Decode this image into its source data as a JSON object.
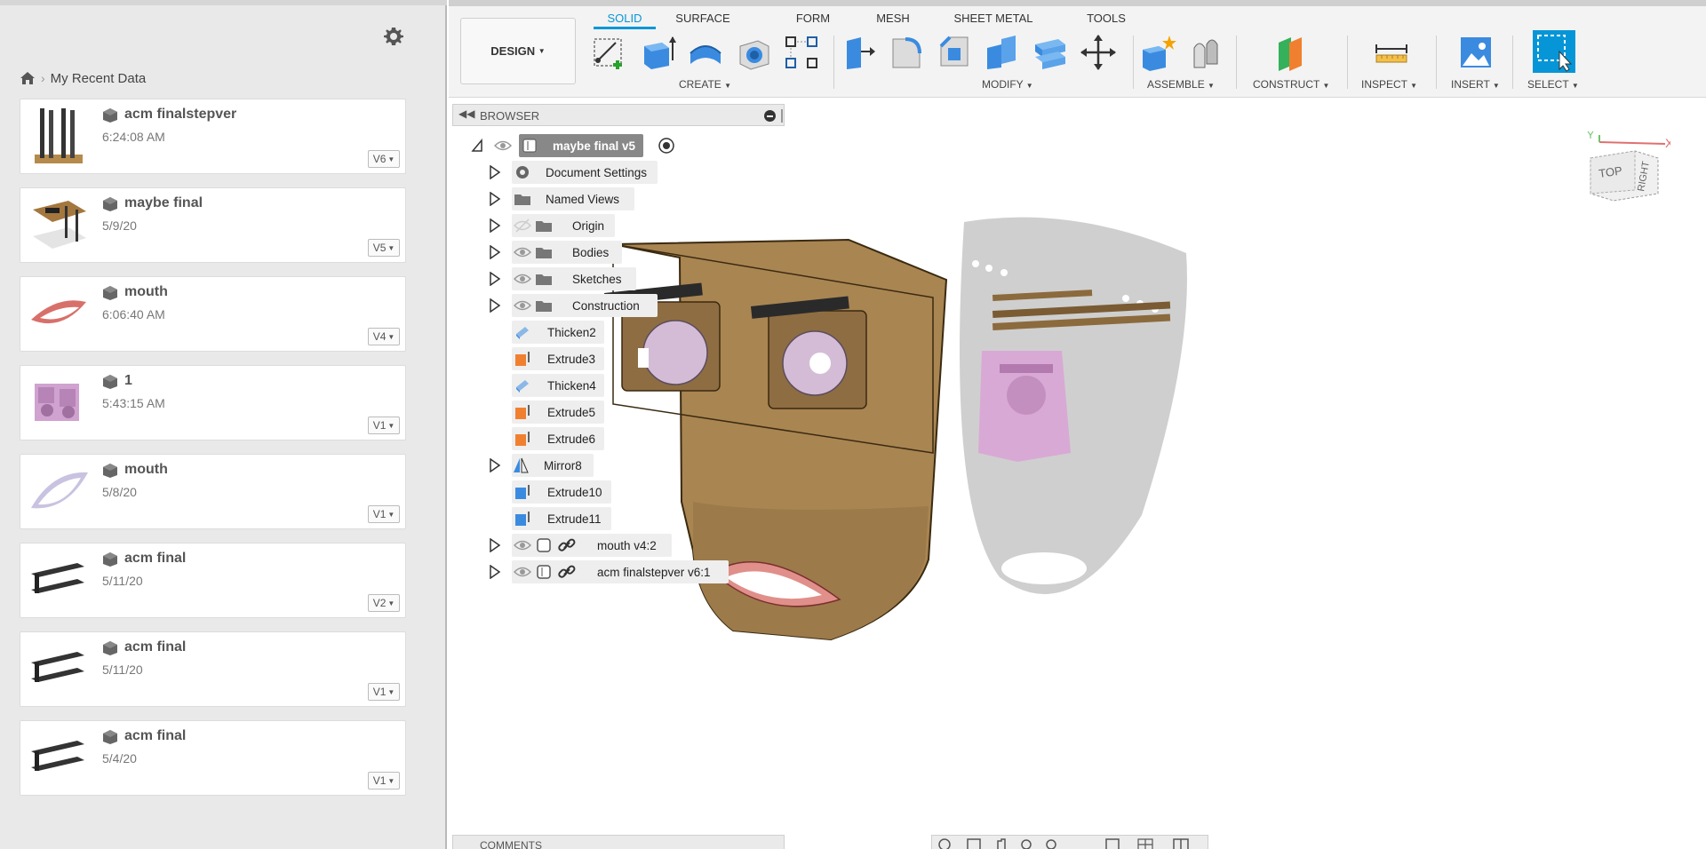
{
  "left_panel": {
    "breadcrumb_label": "My Recent Data",
    "files": [
      {
        "name": "acm finalstepver",
        "date": "6:24:08 AM",
        "version": "V6"
      },
      {
        "name": "maybe final",
        "date": "5/9/20",
        "version": "V5"
      },
      {
        "name": "mouth",
        "date": "6:06:40 AM",
        "version": "V4"
      },
      {
        "name": "1",
        "date": "5:43:15 AM",
        "version": "V1"
      },
      {
        "name": "mouth",
        "date": "5/8/20",
        "version": "V1"
      },
      {
        "name": "acm final",
        "date": "5/11/20",
        "version": "V2"
      },
      {
        "name": "acm final",
        "date": "5/11/20",
        "version": "V1"
      },
      {
        "name": "acm final",
        "date": "5/4/20",
        "version": "V1"
      }
    ]
  },
  "toolbar": {
    "design_label": "DESIGN",
    "tabs": [
      "SOLID",
      "SURFACE",
      "FORM",
      "MESH",
      "SHEET METAL",
      "TOOLS"
    ],
    "active_tab": "SOLID",
    "groups": [
      "CREATE",
      "MODIFY",
      "ASSEMBLE",
      "CONSTRUCT",
      "INSPECT",
      "INSERT",
      "SELECT"
    ],
    "accent_color": "#0696d7"
  },
  "browser": {
    "title": "BROWSER",
    "root": "maybe final v5",
    "items": [
      {
        "label": "Document Settings",
        "icon": "gear-icon"
      },
      {
        "label": "Named Views",
        "icon": "folder-icon"
      },
      {
        "label": "Origin",
        "icon": "folder-icon"
      },
      {
        "label": "Bodies",
        "icon": "folder-icon"
      },
      {
        "label": "Sketches",
        "icon": "folder-icon"
      },
      {
        "label": "Construction",
        "icon": "folder-icon"
      },
      {
        "label": "Thicken2",
        "icon": "thicken-icon"
      },
      {
        "label": "Extrude3",
        "icon": "extrude-icon"
      },
      {
        "label": "Thicken4",
        "icon": "thicken-icon"
      },
      {
        "label": "Extrude5",
        "icon": "extrude-icon"
      },
      {
        "label": "Extrude6",
        "icon": "extrude-icon"
      },
      {
        "label": "Mirror8",
        "icon": "mirror-icon"
      },
      {
        "label": "Extrude10",
        "icon": "extrude-icon"
      },
      {
        "label": "Extrude11",
        "icon": "extrude-icon"
      },
      {
        "label": "mouth v4:2",
        "icon": "component-link-icon"
      },
      {
        "label": "acm finalstepver v6:1",
        "icon": "component-link-icon"
      }
    ]
  },
  "viewcube": {
    "top": "TOP",
    "right": "RIGHT",
    "x_axis": "X",
    "y_axis": "Y"
  },
  "comments_label": "COMMENTS"
}
